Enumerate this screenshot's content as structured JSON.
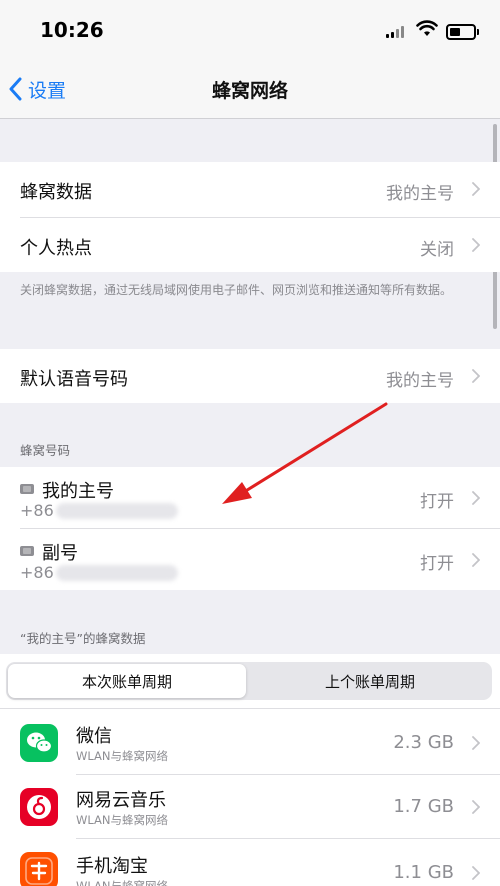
{
  "status_bar": {
    "time": "10:26"
  },
  "nav": {
    "back_label": "设置",
    "title": "蜂窝网络"
  },
  "cellular_data": {
    "label": "蜂窝数据",
    "value": "我的主号"
  },
  "hotspot": {
    "label": "个人热点",
    "value": "关闭"
  },
  "cellular_footnote": "关闭蜂窝数据，通过无线局域网使用电子邮件、网页浏览和推送通知等所有数据。",
  "default_voice": {
    "label": "默认语音号码",
    "value": "我的主号"
  },
  "cellular_numbers": {
    "header": "蜂窝号码",
    "lines": [
      {
        "name": "我的主号",
        "number_prefix": "+86",
        "status": "打开"
      },
      {
        "name": "副号",
        "number_prefix": "+86",
        "status": "打开"
      }
    ]
  },
  "usage": {
    "header": "“我的主号”的蜂窝数据",
    "segments": {
      "current": "本次账单周期",
      "previous": "上个账单周期",
      "selected": "current"
    },
    "apps": [
      {
        "name": "微信",
        "subtitle": "WLAN与蜂窝网络",
        "size": "2.3 GB",
        "icon": "wechat-icon",
        "color": "#07c160"
      },
      {
        "name": "网易云音乐",
        "subtitle": "WLAN与蜂窝网络",
        "size": "1.7 GB",
        "icon": "netease-music-icon",
        "color": "#e60026"
      },
      {
        "name": "手机淘宝",
        "subtitle": "WLAN与蜂窝网络",
        "size": "1.1 GB",
        "icon": "taobao-icon",
        "color": "#ff5000"
      }
    ]
  },
  "annotation": {
    "arrow_color": "#e02020"
  },
  "colors": {
    "accent": "#1a7cf5",
    "background": "#efeff4"
  }
}
